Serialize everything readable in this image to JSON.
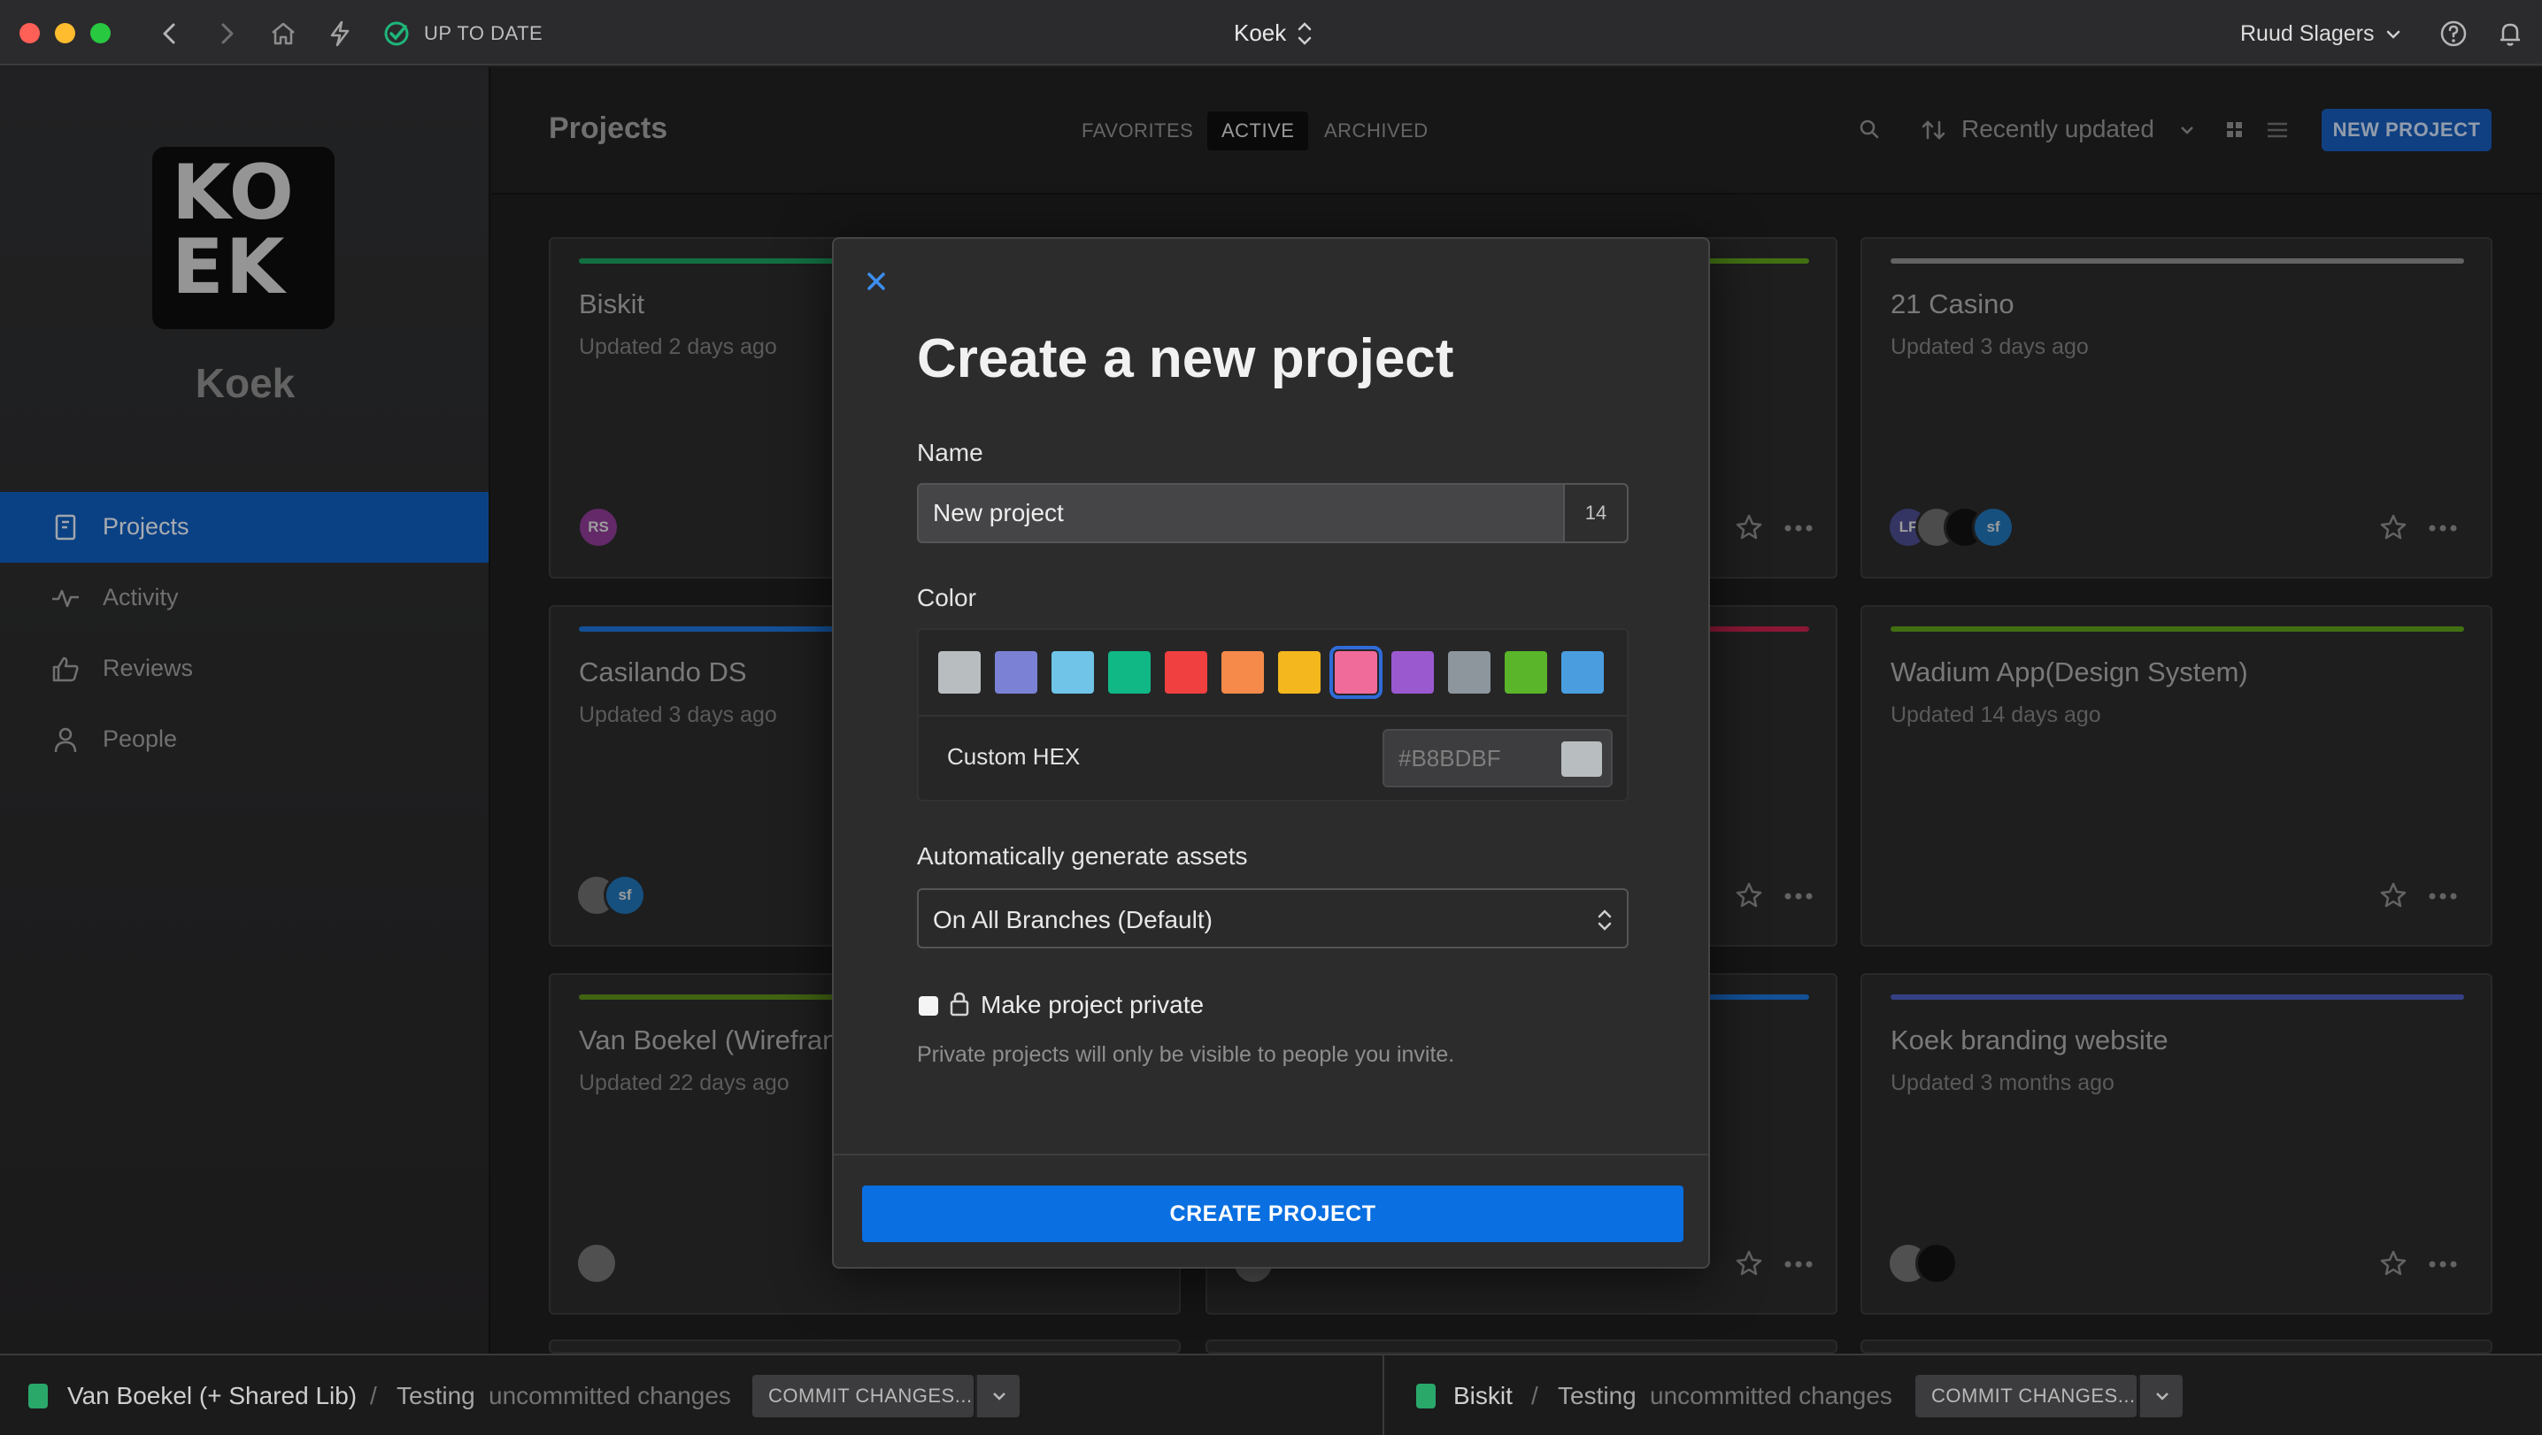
{
  "titlebar": {
    "status": "UP TO DATE",
    "app_title": "Koek",
    "user_name": "Ruud Slagers",
    "icons": [
      "chevron-left-icon",
      "chevron-right-icon",
      "home-icon",
      "bolt-icon",
      "check-circle-icon",
      "help-icon",
      "bell-icon"
    ]
  },
  "sidebar": {
    "logo_lines": [
      "KO",
      "EK"
    ],
    "workspace": "Koek",
    "items": [
      {
        "label": "Projects",
        "icon": "projects-icon",
        "active": true
      },
      {
        "label": "Activity",
        "icon": "activity-icon",
        "active": false
      },
      {
        "label": "Reviews",
        "icon": "thumbs-up-icon",
        "active": false
      },
      {
        "label": "People",
        "icon": "person-icon",
        "active": false
      }
    ]
  },
  "header": {
    "title": "Projects",
    "tabs": [
      {
        "label": "FAVORITES",
        "active": false
      },
      {
        "label": "ACTIVE",
        "active": true
      },
      {
        "label": "ARCHIVED",
        "active": false
      }
    ],
    "sort_label": "Recently updated",
    "new_project": "NEW PROJECT"
  },
  "projects": [
    {
      "title": "Biskit",
      "updated": "Updated 2 days ago",
      "color": "#1a9a5a",
      "avatars": [
        "RS"
      ]
    },
    {
      "title": "21 Casino",
      "updated": "Updated 3 days ago",
      "color": "#8a8a8a",
      "avatars": [
        "LF",
        "",
        "",
        "sf"
      ]
    },
    {
      "title": "Casilando DS",
      "updated": "Updated 3 days ago",
      "color": "#1b6fd0",
      "avatars": [
        "",
        "sf"
      ]
    },
    {
      "title": "Wadium App(Design System)",
      "updated": "Updated 14 days ago",
      "color": "#5a9a1a",
      "avatars": []
    },
    {
      "title": "Van Boekel (Wirefran",
      "updated": "Updated 22 days ago",
      "color": "#5a8a1a",
      "avatars": [
        ""
      ]
    },
    {
      "title": "Koek branding website",
      "updated": "Updated 3 months ago",
      "color": "#4a5ab8",
      "avatars": [
        "",
        ""
      ]
    }
  ],
  "footer": {
    "left": {
      "project": "Van Boekel (+ Shared Lib)",
      "branch": "Testing",
      "status": "uncommitted changes",
      "commit": "COMMIT CHANGES..."
    },
    "right": {
      "project": "Biskit",
      "branch": "Testing",
      "status": "uncommitted changes",
      "commit": "COMMIT CHANGES..."
    }
  },
  "modal": {
    "title": "Create a new project",
    "name_label": "Name",
    "name_value": "New project",
    "name_count": "14",
    "color_label": "Color",
    "swatches": [
      "#b8bdbf",
      "#7b82d6",
      "#6fc4e8",
      "#10b886",
      "#f04040",
      "#f58a4a",
      "#f4b71e",
      "#f06a9a",
      "#9b59d0",
      "#8c969c",
      "#5ab52a",
      "#4a9ee0"
    ],
    "selected_swatch": 7,
    "custom_hex_label": "Custom HEX",
    "custom_hex_placeholder": "#B8BDBF",
    "custom_hex_color": "#b8bdbf",
    "assets_label": "Automatically generate assets",
    "assets_value": "On All Branches (Default)",
    "private_label": "Make project private",
    "private_note": "Private projects will only be visible to people you invite.",
    "create_button": "CREATE PROJECT"
  }
}
